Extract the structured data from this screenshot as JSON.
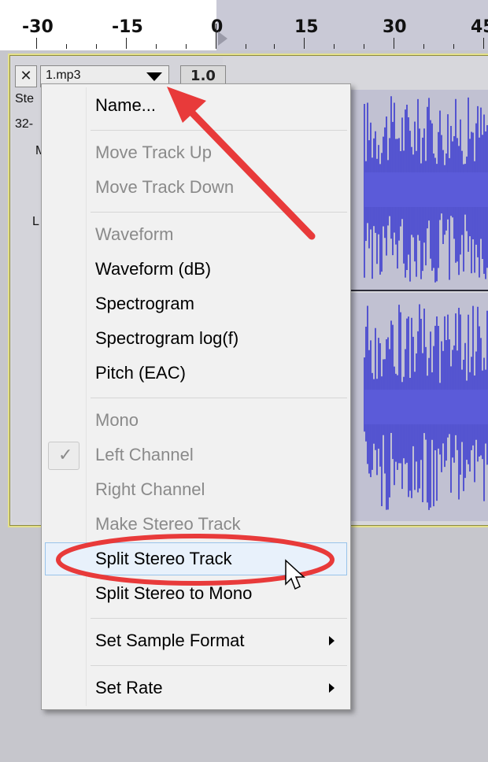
{
  "ruler": {
    "ticks": [
      "-30",
      "-15",
      "0",
      "15",
      "30",
      "45"
    ]
  },
  "track": {
    "close_label": "✕",
    "name": "1.mp3",
    "gain": "1.0",
    "side_text_1": "Ste",
    "side_text_2": "32-",
    "side_text_3": "M",
    "side_text_4": "L"
  },
  "menu": {
    "name": "Name...",
    "move_up": "Move Track Up",
    "move_down": "Move Track Down",
    "waveform": "Waveform",
    "waveform_db": "Waveform (dB)",
    "spectrogram": "Spectrogram",
    "spectrogram_log": "Spectrogram log(f)",
    "pitch": "Pitch (EAC)",
    "mono": "Mono",
    "left_channel": "Left Channel",
    "right_channel": "Right Channel",
    "make_stereo": "Make Stereo Track",
    "split_stereo": "Split Stereo Track",
    "split_stereo_mono": "Split Stereo to Mono",
    "sample_format": "Set Sample Format",
    "set_rate": "Set Rate",
    "check_glyph": "✓"
  },
  "colors": {
    "waveform": "#3a3ad0",
    "annotation": "#e83a3a",
    "track_border": "#e4e08a"
  }
}
